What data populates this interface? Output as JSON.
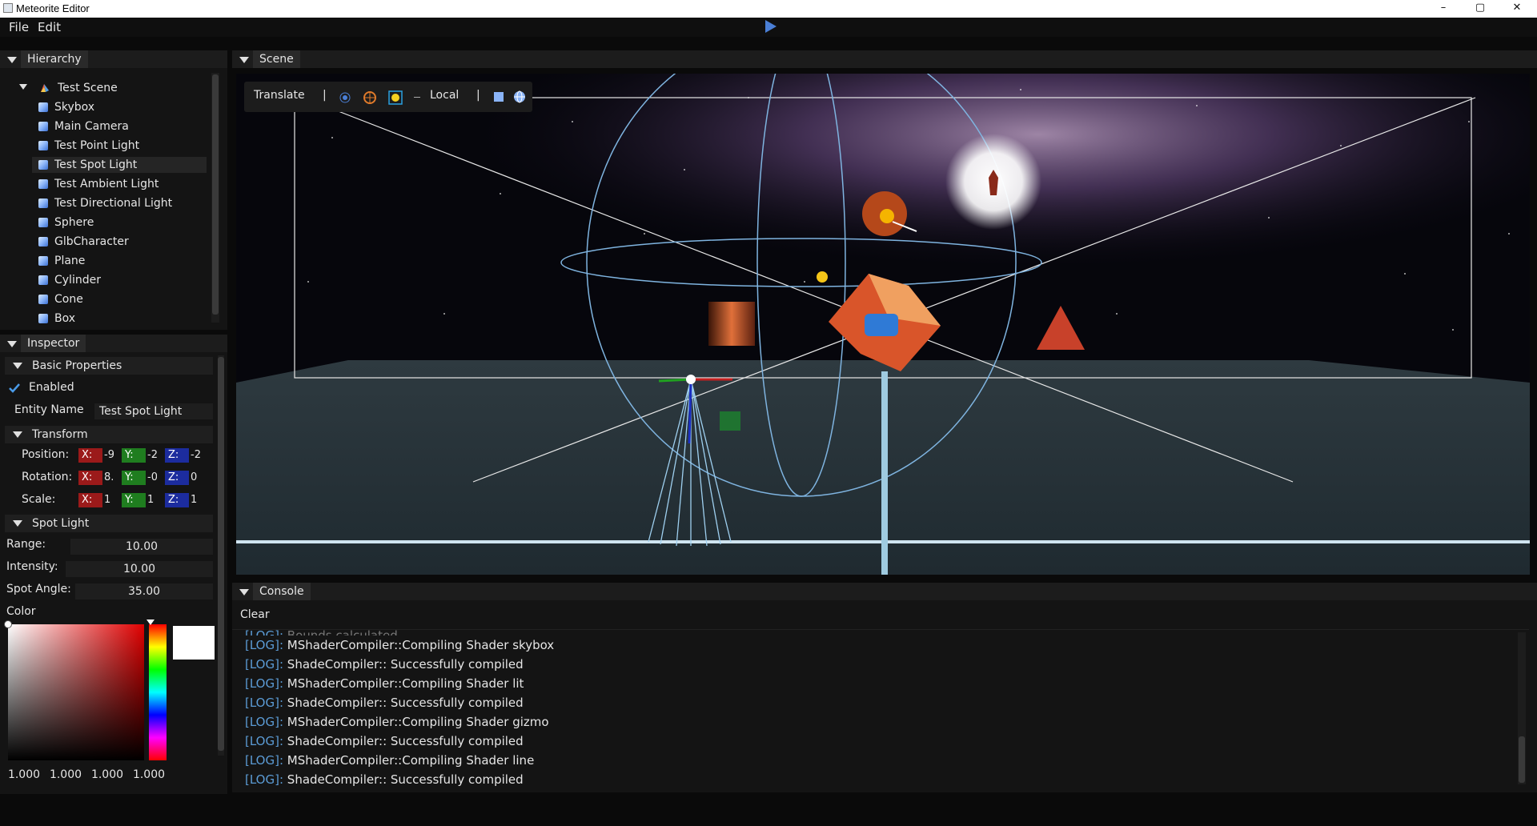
{
  "window": {
    "title": "Meteorite Editor",
    "minimize": "–",
    "maximize": "▢",
    "close": "✕"
  },
  "menu": {
    "file": "File",
    "edit": "Edit"
  },
  "hierarchy": {
    "tab": "Hierarchy",
    "root": "Test Scene",
    "items": [
      "Skybox",
      "Main Camera",
      "Test Point Light",
      "Test Spot Light",
      "Test Ambient Light",
      "Test Directional Light",
      "Sphere",
      "GlbCharacter",
      "Plane",
      "Cylinder",
      "Cone",
      "Box"
    ],
    "selected": "Test Spot Light"
  },
  "inspector": {
    "tab": "Inspector",
    "basic": {
      "title": "Basic Properties",
      "enabled_label": "Enabled",
      "name_label": "Entity Name",
      "name_value": "Test Spot Light"
    },
    "transform": {
      "title": "Transform",
      "position": {
        "label": "Position:",
        "x": "X:",
        "xv": "-9",
        "y": "Y:",
        "yv": "-2",
        "z": "Z:",
        "zv": "-2"
      },
      "rotation": {
        "label": "Rotation:",
        "x": "X:",
        "xv": "8.",
        "y": "Y:",
        "yv": "-0",
        "z": "Z:",
        "zv": "0"
      },
      "scale": {
        "label": "Scale:",
        "x": "X:",
        "xv": "1",
        "y": "Y:",
        "yv": "1",
        "z": "Z:",
        "zv": "1"
      }
    },
    "spotlight": {
      "title": "Spot Light",
      "range_label": "Range:",
      "range": "10.00",
      "intensity_label": "Intensity:",
      "intensity": "10.00",
      "angle_label": "Spot Angle:",
      "angle": "35.00",
      "color_label": "Color",
      "rgba": [
        "1.000",
        "1.000",
        "1.000",
        "1.000"
      ]
    }
  },
  "scene": {
    "tab": "Scene",
    "toolbar": {
      "mode": "Translate",
      "sep1": "|",
      "space": "Local",
      "sep2": "|"
    }
  },
  "console": {
    "tab": "Console",
    "clear": "Clear",
    "partial": "Bounds calculated",
    "lines": [
      {
        "tag": "[LOG]:",
        "msg": "MShaderCompiler::Compiling Shader skybox"
      },
      {
        "tag": "[LOG]:",
        "msg": "ShadeCompiler:: Successfully compiled"
      },
      {
        "tag": "[LOG]:",
        "msg": "MShaderCompiler::Compiling Shader lit"
      },
      {
        "tag": "[LOG]:",
        "msg": "ShadeCompiler:: Successfully compiled"
      },
      {
        "tag": "[LOG]:",
        "msg": "MShaderCompiler::Compiling Shader gizmo"
      },
      {
        "tag": "[LOG]:",
        "msg": "ShadeCompiler:: Successfully compiled"
      },
      {
        "tag": "[LOG]:",
        "msg": "MShaderCompiler::Compiling Shader line"
      },
      {
        "tag": "[LOG]:",
        "msg": "ShadeCompiler:: Successfully compiled"
      }
    ]
  },
  "colors": {
    "accent": "#4a7fd6",
    "log_tag": "#5b9bd5",
    "axis_x": "#9b1a1a",
    "axis_y": "#1f7d1f",
    "axis_z": "#1c2c9e"
  }
}
